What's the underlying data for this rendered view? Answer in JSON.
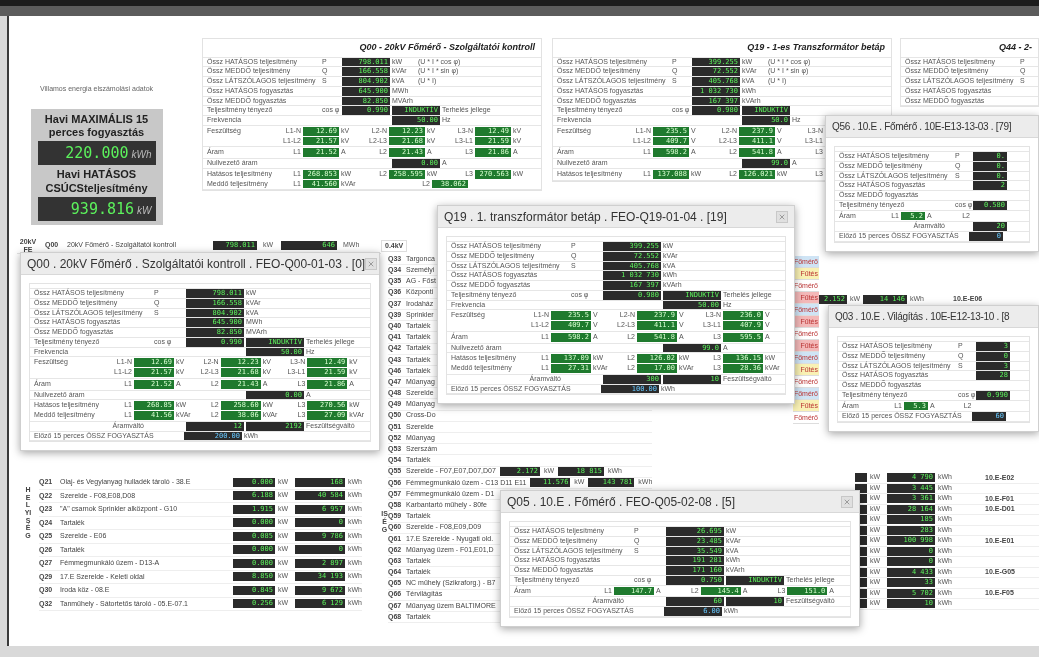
{
  "summary": {
    "caption": "Villamos energia elszámolási adatok",
    "cards": [
      {
        "title": "Havi MAXIMÁLIS 15 perces fogyasztás",
        "value": "220.000",
        "unit": "kWh"
      },
      {
        "title": "Havi HATÁSOS CSÚCSteljesítmény",
        "value": "939.816",
        "unit": "kW"
      }
    ]
  },
  "panels": [
    {
      "title": "Q00 - 20kV Főmérő - Szolgáltatói kontroll",
      "rows": [
        {
          "kind": "power",
          "label": "Össz HATÁSOS teljesítmény",
          "symbol": "P",
          "value": "798.011",
          "unit": "kW",
          "note": "(U * I * cos φ)"
        },
        {
          "kind": "power",
          "label": "Össz MEDDŐ teljesítmény",
          "symbol": "Q",
          "value": "166.558",
          "unit": "kVAr",
          "note": "(U * I * sin φ)"
        },
        {
          "kind": "power",
          "label": "Össz LÁTSZÓLAGOS teljesítmény",
          "symbol": "S",
          "value": "804.902",
          "unit": "kVA",
          "note": "(U * I)"
        },
        {
          "kind": "energy",
          "label": "Össz HATÁSOS fogyasztás",
          "value": "645.900",
          "unit": "MWh"
        },
        {
          "kind": "energy",
          "label": "Össz MEDDŐ fogyasztás",
          "value": "82.850",
          "unit": "MVArh"
        },
        {
          "kind": "pf",
          "label": "Teljesítmény tényező",
          "symbol": "cos φ",
          "value": "0.990",
          "mode": "INDUKTÍV",
          "note": "Terhelés jellege"
        },
        {
          "kind": "single",
          "label": "Frekvencia",
          "value": "50.00",
          "unit": "Hz"
        },
        {
          "kind": "phases",
          "lines": [
            {
              "label": "Feszültség",
              "cells": [
                {
                  "tag": "L1-N",
                  "value": "12.69",
                  "unit": "kV"
                },
                {
                  "tag": "L2-N",
                  "value": "12.23",
                  "unit": "kV"
                },
                {
                  "tag": "L3-N",
                  "value": "12.49",
                  "unit": "kV"
                }
              ]
            },
            {
              "cells": [
                {
                  "tag": "L1-L2",
                  "value": "21.57",
                  "unit": "kV"
                },
                {
                  "tag": "L2-L3",
                  "value": "21.68",
                  "unit": "kV"
                },
                {
                  "tag": "L3-L1",
                  "value": "21.59",
                  "unit": "kV"
                }
              ]
            }
          ]
        },
        {
          "kind": "phases",
          "lines": [
            {
              "label": "Áram",
              "cells": [
                {
                  "tag": "L1",
                  "value": "21.52",
                  "unit": "A"
                },
                {
                  "tag": "L2",
                  "value": "21.43",
                  "unit": "A"
                },
                {
                  "tag": "L3",
                  "value": "21.86",
                  "unit": "A"
                }
              ]
            }
          ]
        },
        {
          "kind": "single",
          "label": "Nullvezető áram",
          "value": "0.00",
          "unit": "A"
        },
        {
          "kind": "phases",
          "lines": [
            {
              "label": "Hatásos teljesítmény",
              "cells": [
                {
                  "tag": "L1",
                  "value": "268.853",
                  "unit": "kW"
                },
                {
                  "tag": "L2",
                  "value": "258.595",
                  "unit": "kW"
                },
                {
                  "tag": "L3",
                  "value": "270.563",
                  "unit": "kW"
                }
              ]
            },
            {
              "label": "Meddő teljesítmény",
              "cells": [
                {
                  "tag": "L1",
                  "value": "41.560",
                  "unit": "kVAr"
                },
                {
                  "tag": "L2",
                  "value": "38.062"
                }
              ]
            }
          ]
        }
      ]
    },
    {
      "title": "Q19 - 1-es Transzformátor betáp",
      "rows": [
        {
          "kind": "power",
          "label": "Össz HATÁSOS teljesítmény",
          "symbol": "P",
          "value": "399.255",
          "unit": "kW",
          "note": "(U * I * cos φ)"
        },
        {
          "kind": "power",
          "label": "Össz MEDDŐ teljesítmény",
          "symbol": "Q",
          "value": "72.552",
          "unit": "kVAr",
          "note": "(U * I * sin φ)"
        },
        {
          "kind": "power",
          "label": "Össz LÁTSZÓLAGOS teljesítmény",
          "symbol": "S",
          "value": "405.768",
          "unit": "kVA",
          "note": "(U * I)"
        },
        {
          "kind": "energy",
          "label": "Össz HATÁSOS fogyasztás",
          "value": "1 032 730",
          "unit": "kWh"
        },
        {
          "kind": "energy",
          "label": "Össz MEDDŐ fogyasztás",
          "value": "167 397",
          "unit": "kVArh"
        },
        {
          "kind": "pf",
          "label": "Teljesítmény tényező",
          "symbol": "cos φ",
          "value": "0.980",
          "mode": "INDUKTÍV"
        },
        {
          "kind": "single",
          "label": "Frekvencia",
          "value": "50.0",
          "unit": "Hz"
        },
        {
          "kind": "phases",
          "lines": [
            {
              "label": "Feszültség",
              "cells": [
                {
                  "tag": "L1-N",
                  "value": "235.5",
                  "unit": "V"
                },
                {
                  "tag": "L2-N",
                  "value": "237.9",
                  "unit": "V"
                },
                {
                  "tag": "L3-N"
                }
              ]
            },
            {
              "cells": [
                {
                  "tag": "L1-L2",
                  "value": "409.7",
                  "unit": "V"
                },
                {
                  "tag": "L2-L3",
                  "value": "411.1",
                  "unit": "V"
                },
                {
                  "tag": "L3-L1"
                }
              ]
            }
          ]
        },
        {
          "kind": "phases",
          "lines": [
            {
              "label": "Áram",
              "cells": [
                {
                  "tag": "L1",
                  "value": "598.2",
                  "unit": "A"
                },
                {
                  "tag": "L2",
                  "value": "541.8",
                  "unit": "A"
                },
                {
                  "tag": "L3"
                }
              ]
            }
          ]
        },
        {
          "kind": "single",
          "label": "Nullvezető áram",
          "value": "99.0",
          "unit": "A"
        },
        {
          "kind": "phases",
          "lines": [
            {
              "label": "Hatásos teljesítmény",
              "cells": [
                {
                  "tag": "L1",
                  "value": "137.088",
                  "unit": "kW"
                },
                {
                  "tag": "L2",
                  "value": "126.021",
                  "unit": "kW"
                },
                {
                  "tag": "L3"
                }
              ]
            }
          ]
        }
      ]
    },
    {
      "title": "Q44 - 2-",
      "rows": [
        {
          "kind": "power",
          "label": "Össz HATÁSOS teljesítmény",
          "symbol": "P"
        },
        {
          "kind": "power",
          "label": "Össz MEDDŐ teljesítmény",
          "symbol": "Q"
        },
        {
          "kind": "power",
          "label": "Össz LÁTSZÓLAGOS teljesítmény",
          "symbol": "S"
        },
        {
          "kind": "energy",
          "label": "Össz HATÁSOS fogyasztás"
        },
        {
          "kind": "energy",
          "label": "Össz MEDDŐ fogyasztás"
        }
      ]
    }
  ],
  "table_header": {
    "section": "20kV FE",
    "code": "Q00",
    "name": "20kV Főmérő - Szolgáltatói kontroll",
    "power": "798.011",
    "power_unit": "kW",
    "energy": "646",
    "energy_unit": "MWh",
    "voltage": "0.4kV"
  },
  "left_rooms": {
    "vertical_label": "HELYISÉG",
    "rows": [
      {
        "code": "Q21",
        "name": "Olaj- és Vegyianyag hulladék tároló - 38.E",
        "power": "0.000",
        "power_unit": "kW",
        "energy": "168",
        "energy_unit": "kWh"
      },
      {
        "code": "Q22",
        "name": "Szerelde - F08,E08,D08",
        "power": "6.188",
        "power_unit": "kW",
        "energy": "40 584",
        "energy_unit": "kWh"
      },
      {
        "code": "Q23",
        "name": "\"A\" csarnok Sprinkler alközpont - G10",
        "power": "1.915",
        "power_unit": "kW",
        "energy": "6 957",
        "energy_unit": "kWh"
      },
      {
        "code": "Q24",
        "name": "Tartalék",
        "power": "0.000",
        "power_unit": "kW",
        "energy": "0",
        "energy_unit": "kWh"
      },
      {
        "code": "Q25",
        "name": "Szerelde - E06",
        "power": "0.085",
        "power_unit": "kW",
        "energy": "9 786",
        "energy_unit": "kWh"
      },
      {
        "code": "Q26",
        "name": "Tartalék",
        "power": "0.000",
        "power_unit": "kW",
        "energy": "0",
        "energy_unit": "kWh"
      },
      {
        "code": "Q27",
        "name": "Fémmegmunkáló üzem - D13-A",
        "power": "0.000",
        "power_unit": "kW",
        "energy": "2 897",
        "energy_unit": "kWh"
      },
      {
        "code": "Q29",
        "name": "17.E Szerelde - Keleti oldal",
        "power": "8.850",
        "power_unit": "kW",
        "energy": "34 193",
        "energy_unit": "kWh"
      },
      {
        "code": "Q30",
        "name": "Iroda köz - 08.E",
        "power": "0.845",
        "power_unit": "kW",
        "energy": "9 672",
        "energy_unit": "kWh"
      },
      {
        "code": "Q32",
        "name": "Tanműhely - Sátortetős tároló - 05.E-07.1",
        "power": "0.256",
        "power_unit": "kW",
        "energy": "6 129",
        "energy_unit": "kWh"
      }
    ]
  },
  "mid_rooms": {
    "vertical_label": "ISÉG",
    "rows": [
      {
        "code": "Q33",
        "name": "Targonca"
      },
      {
        "code": "Q34",
        "name": "Személyi"
      },
      {
        "code": "Q35",
        "name": "AG - Főst"
      },
      {
        "code": "Q36",
        "name": "Központi"
      },
      {
        "code": "Q37",
        "name": "Irodaház"
      },
      {
        "code": "Q39",
        "name": "Sprinkler"
      },
      {
        "code": "Q40",
        "name": "Tartalék"
      },
      {
        "code": "Q41",
        "name": "Tartalék"
      },
      {
        "code": "Q42",
        "name": "Tartalék"
      },
      {
        "code": "Q43",
        "name": "Tartalék"
      },
      {
        "code": "Q46",
        "name": "Tartalék"
      },
      {
        "code": "Q47",
        "name": "Műanyag"
      },
      {
        "code": "Q48",
        "name": "Szerelde"
      },
      {
        "code": "Q49",
        "name": "Műanyag"
      },
      {
        "code": "Q50",
        "name": "Cross-Do"
      },
      {
        "code": "Q51",
        "name": "Szerelde"
      },
      {
        "code": "Q52",
        "name": "Műanyag"
      },
      {
        "code": "Q53",
        "name": "Szerszám"
      },
      {
        "code": "Q54",
        "name": "Tartalék"
      },
      {
        "code": "Q55",
        "name": "Szerelde - F07,E07,D07,D07",
        "power": "2.172",
        "power_unit": "kW",
        "energy": "18 815",
        "energy_unit": "kWh"
      },
      {
        "code": "Q56",
        "name": "Fémmegmunkáló üzem - C13 D11 E11",
        "power": "11.576",
        "power_unit": "kW",
        "energy": "143 781",
        "energy_unit": "kWh"
      },
      {
        "code": "Q57",
        "name": "Fémmegmunkáló üzem - D1"
      },
      {
        "code": "Q58",
        "name": "Karbantartó műhely - 80fe"
      },
      {
        "code": "Q59",
        "name": "Tartalék"
      },
      {
        "code": "Q60",
        "name": "Szerelde - F08,E09,D09"
      },
      {
        "code": "Q61",
        "name": "17.E Szerelde - Nyugati old."
      },
      {
        "code": "Q62",
        "name": "Műanyag üzem - F01,E01,D"
      },
      {
        "code": "Q63",
        "name": "Tartalék"
      },
      {
        "code": "Q64",
        "name": "Tartalék"
      },
      {
        "code": "Q65",
        "name": "NC műhely (Szikraforg.) - B7"
      },
      {
        "code": "Q66",
        "name": "Térvilágítás"
      },
      {
        "code": "Q67",
        "name": "Műanyag üzem BALTIMORE"
      },
      {
        "code": "Q68",
        "name": "Tartalék"
      }
    ]
  },
  "status_tags": [
    {
      "label": "Főmérő",
      "color": "#cfe4f5"
    },
    {
      "label": "Fűtés",
      "color": "#f9f1b4"
    },
    {
      "label": "Főmérő",
      "color": "#ffffff"
    },
    {
      "label": "Fűtés",
      "color": "#f3b8b8"
    },
    {
      "label": "Főmérő",
      "color": "#cfe4f5"
    },
    {
      "label": "Fűtés",
      "color": "#f3b8b8"
    },
    {
      "label": "Főmérő",
      "color": "#ffffff"
    },
    {
      "label": "Fűtés",
      "color": "#f3b8b8"
    },
    {
      "label": "Főmérő",
      "color": "#cfe4f5"
    },
    {
      "label": "Fűtés",
      "color": "#f9f1b4"
    },
    {
      "label": "Főmérő",
      "color": "#ffffff"
    },
    {
      "label": "Főmérő",
      "color": "#cfe4f5"
    },
    {
      "label": "Fűtés",
      "color": "#f9f1b4"
    },
    {
      "label": "Főmérő",
      "color": "#ffffff"
    }
  ],
  "right_rows": {
    "top": {
      "power": "2.152",
      "power_unit": "kW",
      "energy": "14 146",
      "energy_unit": "kWh",
      "code": "10.E-E06"
    },
    "rows": [
      {
        "power_unit": "kW",
        "energy": "4 790",
        "energy_unit": "kWh",
        "code": "10.E-E02"
      },
      {
        "power_unit": "kW",
        "energy": "3 445",
        "energy_unit": "kWh"
      },
      {
        "power_unit": "kW",
        "energy": "3 361",
        "energy_unit": "kWh",
        "code": "10.E-F01"
      },
      {
        "power_unit": "kW",
        "energy": "28 164",
        "energy_unit": "kWh",
        "code": "10.E-D01"
      },
      {
        "power_unit": "kW",
        "energy": "185",
        "energy_unit": "kWh"
      },
      {
        "power_unit": "kW",
        "energy": "283",
        "energy_unit": "kWh"
      },
      {
        "power_unit": "kW",
        "energy": "100 998",
        "energy_unit": "kWh",
        "code": "10.E-E01"
      },
      {
        "power_unit": "kW",
        "energy": "0",
        "energy_unit": "kWh"
      },
      {
        "power_unit": "kW",
        "energy": "0",
        "energy_unit": "kWh"
      },
      {
        "power_unit": "kW",
        "energy": "4 433",
        "energy_unit": "kWh",
        "code": "10.E-G05"
      },
      {
        "power_unit": "kW",
        "energy": "33",
        "energy_unit": "kWh"
      },
      {
        "power_unit": "kW",
        "energy": "5 702",
        "energy_unit": "kWh",
        "code": "10.E-F05"
      },
      {
        "power_unit": "kW",
        "energy": "10",
        "energy_unit": "kWh"
      }
    ]
  },
  "windows": [
    {
      "title": "Q00 . 20kV Főmérő . Szolgáltatói kontroll . FEO-Q00-01-03 . [0]",
      "rows": [
        {
          "kind": "power",
          "label": "Össz HATÁSOS teljesítmény",
          "symbol": "P",
          "value": "798.011",
          "unit": "kW"
        },
        {
          "kind": "power",
          "label": "Össz MEDDŐ teljesítmény",
          "symbol": "Q",
          "value": "166.558",
          "unit": "kVAr"
        },
        {
          "kind": "power",
          "label": "Össz LÁTSZÓLAGOS teljesítmény",
          "symbol": "S",
          "value": "804.902",
          "unit": "kVA"
        },
        {
          "kind": "energy",
          "label": "Össz HATÁSOS fogyasztás",
          "value": "645.900",
          "unit": "MWh"
        },
        {
          "kind": "energy",
          "label": "Össz MEDDŐ fogyasztás",
          "value": "82.850",
          "unit": "MVArh"
        },
        {
          "kind": "pf",
          "label": "Teljesítmény tényező",
          "symbol": "cos φ",
          "value": "0.990",
          "mode": "INDUKTÍV",
          "note": "Terhelés jellege"
        },
        {
          "kind": "single",
          "label": "Frekvencia",
          "value": "50.00",
          "unit": "Hz"
        },
        {
          "kind": "phases",
          "lines": [
            {
              "label": "Feszültség",
              "cells": [
                {
                  "tag": "L1-N",
                  "value": "12.69",
                  "unit": "kV"
                },
                {
                  "tag": "L2-N",
                  "value": "12.23",
                  "unit": "kV"
                },
                {
                  "tag": "L3-N",
                  "value": "12.49",
                  "unit": "kV"
                }
              ]
            },
            {
              "cells": [
                {
                  "tag": "L1-L2",
                  "value": "21.57",
                  "unit": "kV"
                },
                {
                  "tag": "L2-L3",
                  "value": "21.68",
                  "unit": "kV"
                },
                {
                  "tag": "L3-L1",
                  "value": "21.59",
                  "unit": "kV"
                }
              ]
            }
          ]
        },
        {
          "kind": "phases",
          "lines": [
            {
              "label": "Áram",
              "cells": [
                {
                  "tag": "L1",
                  "value": "21.52",
                  "unit": "A"
                },
                {
                  "tag": "L2",
                  "value": "21.43",
                  "unit": "A"
                },
                {
                  "tag": "L3",
                  "value": "21.86",
                  "unit": "A"
                }
              ]
            }
          ]
        },
        {
          "kind": "single",
          "label": "Nullvezető áram",
          "value": "0.00",
          "unit": "A"
        },
        {
          "kind": "phases",
          "lines": [
            {
              "label": "Hatásos teljesítmény",
              "cells": [
                {
                  "tag": "L1",
                  "value": "268.85",
                  "unit": "kW"
                },
                {
                  "tag": "L2",
                  "value": "258.60",
                  "unit": "kW"
                },
                {
                  "tag": "L3",
                  "value": "270.56",
                  "unit": "kW"
                }
              ]
            },
            {
              "label": "Meddő teljesítmény",
              "cells": [
                {
                  "tag": "L1",
                  "value": "41.56",
                  "unit": "kVAr"
                },
                {
                  "tag": "L2",
                  "value": "38.06",
                  "unit": "kVAr"
                },
                {
                  "tag": "L3",
                  "value": "27.09",
                  "unit": "kVAr"
                }
              ]
            }
          ]
        },
        {
          "kind": "ratio",
          "label": "Áramváltó",
          "value": "12",
          "value2": "2192",
          "note": "Feszültségváltó"
        },
        {
          "kind": "total",
          "label": "Előző 15 perces ÖSSZ FOGYASZTÁS",
          "value": "200.00",
          "unit": "kWh"
        }
      ]
    },
    {
      "title": "Q19 . 1. transzformátor betáp . FEO-Q19-01-04 . [19]",
      "rows": [
        {
          "kind": "power",
          "label": "Össz HATÁSOS teljesítmény",
          "symbol": "P",
          "value": "399.255",
          "unit": "kW"
        },
        {
          "kind": "power",
          "label": "Össz MEDDŐ teljesítmény",
          "symbol": "Q",
          "value": "72.552",
          "unit": "kVAr"
        },
        {
          "kind": "power",
          "label": "Össz LÁTSZÓLAGOS teljesítmény",
          "symbol": "S",
          "value": "405.768",
          "unit": "kVA"
        },
        {
          "kind": "energy",
          "label": "Össz HATÁSOS fogyasztás",
          "value": "1 032 730",
          "unit": "kWh"
        },
        {
          "kind": "energy",
          "label": "Össz MEDDŐ fogyasztás",
          "value": "167 397",
          "unit": "kVArh"
        },
        {
          "kind": "pf",
          "label": "Teljesítmény tényező",
          "symbol": "cos φ",
          "value": "0.980",
          "mode": "INDUKTÍV",
          "note": "Terhelés jellege"
        },
        {
          "kind": "single",
          "label": "Frekvencia",
          "value": "50.00",
          "unit": "Hz"
        },
        {
          "kind": "phases",
          "lines": [
            {
              "label": "Feszültség",
              "cells": [
                {
                  "tag": "L1-N",
                  "value": "235.5",
                  "unit": "V"
                },
                {
                  "tag": "L2-N",
                  "value": "237.9",
                  "unit": "V"
                },
                {
                  "tag": "L3-N",
                  "value": "236.0",
                  "unit": "V"
                }
              ]
            },
            {
              "cells": [
                {
                  "tag": "L1-L2",
                  "value": "409.7",
                  "unit": "V"
                },
                {
                  "tag": "L2-L3",
                  "value": "411.1",
                  "unit": "V"
                },
                {
                  "tag": "L3-L1",
                  "value": "407.9",
                  "unit": "V"
                }
              ]
            }
          ]
        },
        {
          "kind": "phases",
          "lines": [
            {
              "label": "Áram",
              "cells": [
                {
                  "tag": "L1",
                  "value": "598.2",
                  "unit": "A"
                },
                {
                  "tag": "L2",
                  "value": "541.8",
                  "unit": "A"
                },
                {
                  "tag": "L3",
                  "value": "595.5",
                  "unit": "A"
                }
              ]
            }
          ]
        },
        {
          "kind": "single",
          "label": "Nullvezető áram",
          "value": "99.0",
          "unit": "A"
        },
        {
          "kind": "phases",
          "lines": [
            {
              "label": "Hatásos teljesítmény",
              "cells": [
                {
                  "tag": "L1",
                  "value": "137.09",
                  "unit": "kW"
                },
                {
                  "tag": "L2",
                  "value": "126.02",
                  "unit": "kW"
                },
                {
                  "tag": "L3",
                  "value": "136.15",
                  "unit": "kW"
                }
              ]
            },
            {
              "label": "Meddő teljesítmény",
              "cells": [
                {
                  "tag": "L1",
                  "value": "27.31",
                  "unit": "kVAr"
                },
                {
                  "tag": "L2",
                  "value": "17.00",
                  "unit": "kVAr"
                },
                {
                  "tag": "L3",
                  "value": "28.36",
                  "unit": "kVAr"
                }
              ]
            }
          ]
        },
        {
          "kind": "ratio",
          "label": "Áramváltó",
          "value": "300",
          "value2": "10",
          "note": "Feszültségváltó"
        },
        {
          "kind": "total",
          "label": "Előző 15 perces ÖSSZ FOGYASZTÁS",
          "value": "100.00",
          "unit": "kWh"
        }
      ]
    },
    {
      "title": "Q56 . 10.E . Főmérő . 10E-E13-13-03 . [79]",
      "rows": [
        {
          "kind": "power",
          "label": "Össz HATÁSOS teljesítmény",
          "symbol": "P",
          "value": "0."
        },
        {
          "kind": "power",
          "label": "Össz MEDDŐ teljesítmény",
          "symbol": "Q",
          "value": "0."
        },
        {
          "kind": "power",
          "label": "Össz LÁTSZÓLAGOS teljesítmény",
          "symbol": "S",
          "value": "0."
        },
        {
          "kind": "energy",
          "label": "Össz HATÁSOS fogyasztás",
          "value": "2"
        },
        {
          "kind": "energy",
          "label": "Össz MEDDŐ fogyasztás"
        },
        {
          "kind": "pf",
          "label": "Teljesítmény tényező",
          "symbol": "cos φ",
          "value": "0.580"
        },
        {
          "kind": "phases",
          "lines": [
            {
              "label": "Áram",
              "cells": [
                {
                  "tag": "L1",
                  "value": "5.2",
                  "unit": "A"
                },
                {
                  "tag": "L2"
                }
              ]
            }
          ]
        },
        {
          "kind": "ratio",
          "label": "Áramváltó",
          "value": "20"
        },
        {
          "kind": "total",
          "label": "Előző 15 perces ÖSSZ FOGYASZTÁS",
          "value": "0"
        }
      ]
    },
    {
      "title": "Q03 . 10.E . Világítás . 10E-E12-13-10 . [8",
      "rows": [
        {
          "kind": "power",
          "label": "Össz HATÁSOS teljesítmény",
          "symbol": "P",
          "value": "3"
        },
        {
          "kind": "power",
          "label": "Össz MEDDŐ teljesítmény",
          "symbol": "Q",
          "value": "0"
        },
        {
          "kind": "power",
          "label": "Össz LÁTSZÓLAGOS teljesítmény",
          "symbol": "S",
          "value": "3"
        },
        {
          "kind": "energy",
          "label": "Össz HATÁSOS fogyasztás",
          "value": "28"
        },
        {
          "kind": "energy",
          "label": "Össz MEDDŐ fogyasztás"
        },
        {
          "kind": "pf",
          "label": "Teljesítmény tényező",
          "symbol": "cos φ",
          "value": "0.990"
        },
        {
          "kind": "phases",
          "lines": [
            {
              "label": "Áram",
              "cells": [
                {
                  "tag": "L1",
                  "value": "5.3",
                  "unit": "A"
                },
                {
                  "tag": "L2"
                }
              ]
            }
          ]
        },
        {
          "kind": "total",
          "label": "Előző 15 perces ÖSSZ FOGYASZTÁS",
          "value": "60"
        }
      ]
    },
    {
      "title": "Q05 . 10.E . Főmérő . FEO-Q05-02-08 . [5]",
      "rows": [
        {
          "kind": "power",
          "label": "Össz HATÁSOS teljesítmény",
          "symbol": "P",
          "value": "26.695",
          "unit": "kW"
        },
        {
          "kind": "power",
          "label": "Össz MEDDŐ teljesítmény",
          "symbol": "Q",
          "value": "23.485",
          "unit": "kVAr"
        },
        {
          "kind": "power",
          "label": "Össz LÁTSZÓLAGOS teljesítmény",
          "symbol": "S",
          "value": "35.549",
          "unit": "kVA"
        },
        {
          "kind": "energy",
          "label": "Össz HATÁSOS fogyasztás",
          "value": "191 281",
          "unit": "kWh"
        },
        {
          "kind": "energy",
          "label": "Össz MEDDŐ fogyasztás",
          "value": "171 160",
          "unit": "kVArh"
        },
        {
          "kind": "pf",
          "label": "Teljesítmény tényező",
          "symbol": "cos φ",
          "value": "0.750",
          "mode": "INDUKTÍV",
          "note": "Terhelés jellege"
        },
        {
          "kind": "phases",
          "lines": [
            {
              "label": "Áram",
              "cells": [
                {
                  "tag": "L1",
                  "value": "147.7",
                  "unit": "A"
                },
                {
                  "tag": "L2",
                  "value": "145.4",
                  "unit": "A"
                },
                {
                  "tag": "L3",
                  "value": "151.0",
                  "unit": "A"
                }
              ]
            }
          ]
        },
        {
          "kind": "ratio",
          "label": "Áramváltó",
          "value": "60",
          "value2": "10",
          "note": "Feszültségváltó"
        },
        {
          "kind": "total",
          "label": "Előző 15 perces ÖSSZ FOGYASZTÁS",
          "value": "6.00",
          "unit": "kWh"
        }
      ]
    }
  ]
}
